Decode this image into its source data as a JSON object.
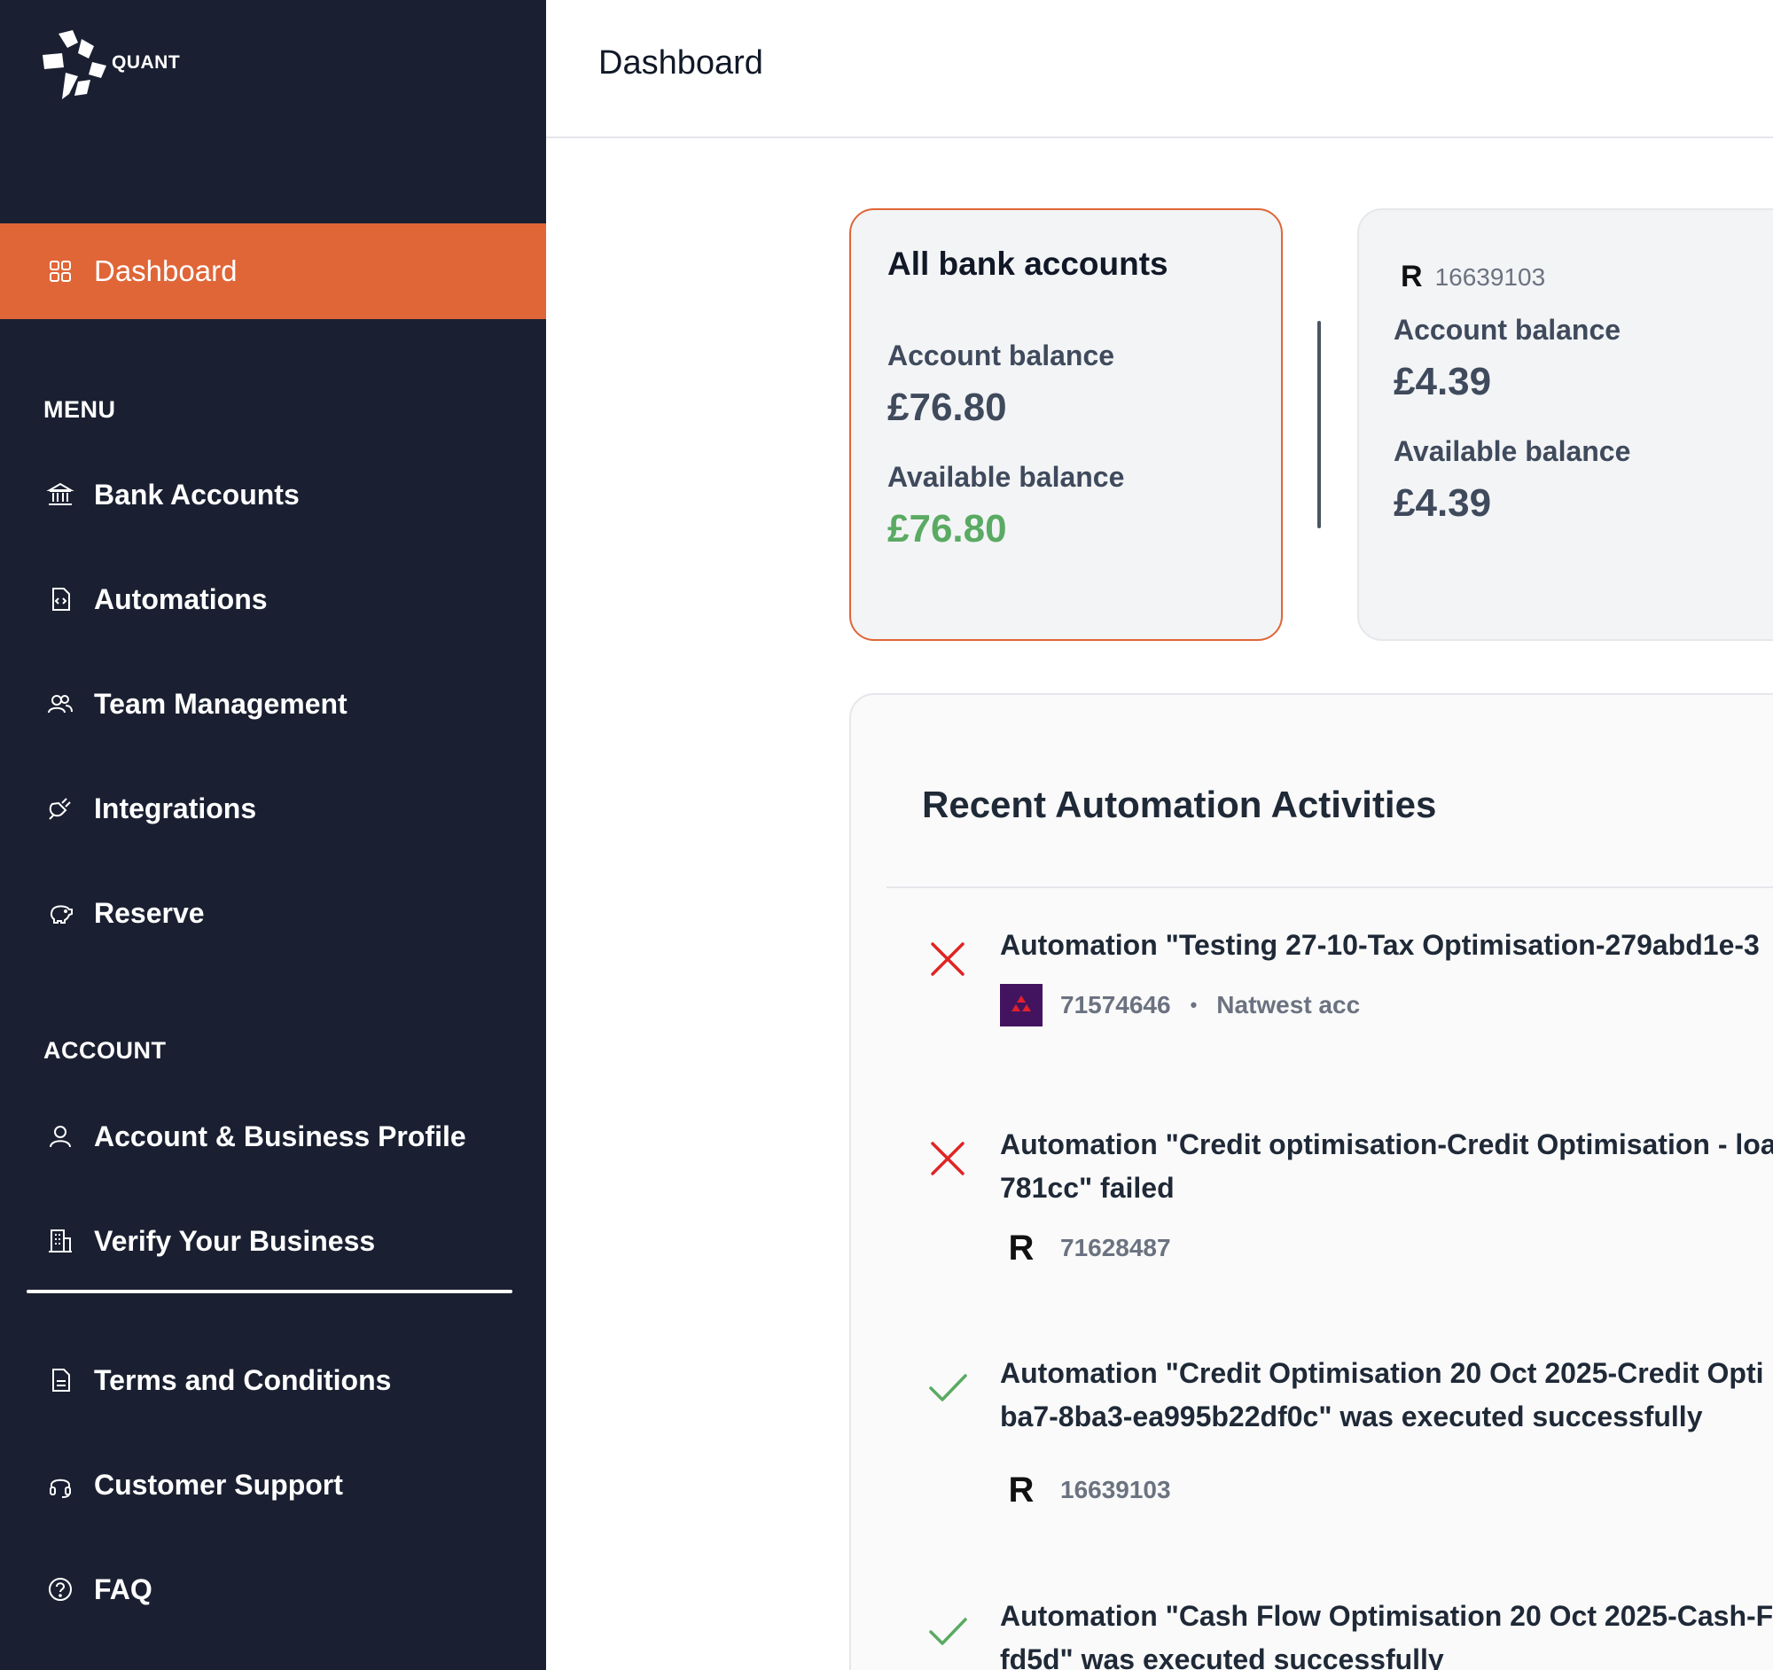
{
  "app": {
    "logo_text": "QUANT",
    "logo_icon": "quant-logo-icon"
  },
  "sidebar": {
    "active_item": {
      "label": "Dashboard",
      "icon": "grid-icon"
    },
    "menu_label": "MENU",
    "menu_items": [
      {
        "label": "Bank Accounts",
        "icon": "bank-icon"
      },
      {
        "label": "Automations",
        "icon": "code-file-icon"
      },
      {
        "label": "Team Management",
        "icon": "users-icon"
      },
      {
        "label": "Integrations",
        "icon": "plug-icon"
      },
      {
        "label": "Reserve",
        "icon": "piggy-bank-icon"
      }
    ],
    "account_label": "ACCOUNT",
    "account_items": [
      {
        "label": "Account & Business Profile",
        "icon": "user-icon"
      },
      {
        "label": "Verify Your Business",
        "icon": "building-icon"
      }
    ],
    "footer_items": [
      {
        "label": "Terms and Conditions",
        "icon": "document-icon"
      },
      {
        "label": "Customer Support",
        "icon": "headset-icon"
      },
      {
        "label": "FAQ",
        "icon": "question-circle-icon"
      }
    ]
  },
  "header": {
    "title": "Dashboard"
  },
  "cards": {
    "all": {
      "title": "All bank accounts",
      "account_balance_label": "Account balance",
      "account_balance": "£76.80",
      "available_balance_label": "Available balance",
      "available_balance": "£76.80"
    },
    "account": {
      "bank_logo": "revolut-icon",
      "account_number": "16639103",
      "account_balance_label": "Account balance",
      "account_balance": "£4.39",
      "available_balance_label": "Available balance",
      "available_balance": "£4.39"
    }
  },
  "activities": {
    "title": "Recent Automation Activities",
    "items": [
      {
        "status": "failed",
        "line1": "Automation \"Testing 27-10-Tax Optimisation-279abd1e-3",
        "line2": "",
        "bank": "natwest-icon",
        "account_number": "71574646",
        "account_name": "Natwest acc"
      },
      {
        "status": "failed",
        "line1": "Automation \"Credit optimisation-Credit Optimisation - loa",
        "line2": "781cc\" failed",
        "bank": "revolut-icon",
        "account_number": "71628487"
      },
      {
        "status": "success",
        "line1": "Automation \"Credit Optimisation 20 Oct 2025-Credit Opti",
        "line2": "ba7-8ba3-ea995b22df0c\" was executed successfully",
        "bank": "revolut-icon",
        "account_number": "16639103"
      },
      {
        "status": "success",
        "line1": "Automation \"Cash Flow Optimisation 20 Oct 2025-Cash-F",
        "line2": "fd5d\" was executed successfully"
      }
    ]
  },
  "colors": {
    "sidebar_bg": "#1a2031",
    "accent": "#e06537",
    "success_green": "#5aaa63",
    "error_red": "#e02424",
    "natwest_purple": "#42145f"
  }
}
